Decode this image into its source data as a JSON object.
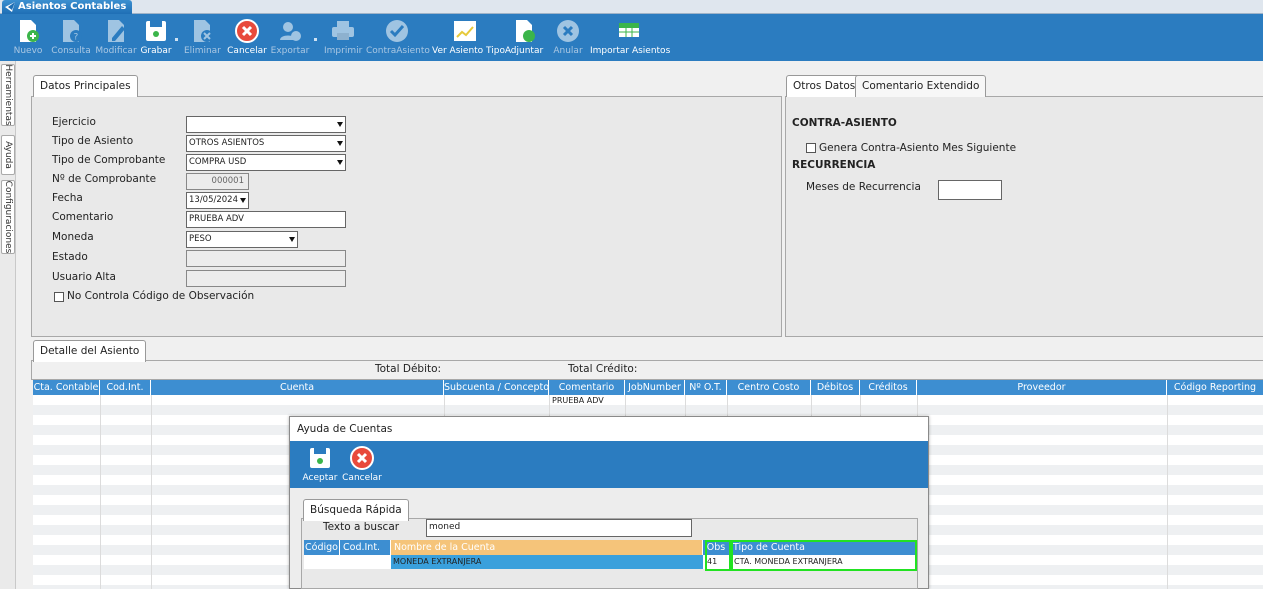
{
  "window": {
    "tab_title": "Asientos Contables"
  },
  "toolbar": {
    "buttons": [
      {
        "label": "Nuevo",
        "icon": "new-document-icon"
      },
      {
        "label": "Consulta",
        "icon": "query-document-icon"
      },
      {
        "label": "Modificar",
        "icon": "edit-document-icon"
      },
      {
        "label": "Grabar",
        "icon": "save-disk-icon"
      },
      {
        "label": "Eliminar",
        "icon": "delete-document-icon"
      },
      {
        "label": "Cancelar",
        "icon": "cancel-circle-icon"
      },
      {
        "label": "Exportar",
        "icon": "export-user-icon"
      },
      {
        "label": "Imprimir",
        "icon": "printer-icon"
      },
      {
        "label": "ContraAsiento",
        "icon": "checkmark-circle-icon"
      },
      {
        "label": "Ver Asiento Tipo",
        "icon": "chart-icon"
      },
      {
        "label": "Adjuntar",
        "icon": "attach-document-icon"
      },
      {
        "label": "Anular",
        "icon": "void-circle-icon"
      },
      {
        "label": "Importar Asientos",
        "icon": "excel-import-icon"
      }
    ]
  },
  "side_tabs": [
    "Herramientas",
    "Ayuda",
    "Configuraciones"
  ],
  "datos_principales": {
    "tab_label": "Datos Principales",
    "ejercicio": {
      "label": "Ejercicio",
      "value": ""
    },
    "tipo_asiento": {
      "label": "Tipo de Asiento",
      "value": "OTROS ASIENTOS"
    },
    "tipo_comprobante": {
      "label": "Tipo de Comprobante",
      "value": "COMPRA USD"
    },
    "nro_comprobante": {
      "label": "Nº de Comprobante",
      "value": "000001"
    },
    "fecha": {
      "label": "Fecha",
      "value": "13/05/2024"
    },
    "comentario": {
      "label": "Comentario",
      "value": "PRUEBA ADV"
    },
    "moneda": {
      "label": "Moneda",
      "value": "PESO"
    },
    "estado": {
      "label": "Estado",
      "value": ""
    },
    "usuario_alta": {
      "label": "Usuario Alta",
      "value": ""
    },
    "no_controla_label": "No Controla Código de Observación"
  },
  "otros_datos": {
    "tab_label": "Otros Datos",
    "tab2_label": "Comentario Extendido",
    "contra_asiento_heading": "CONTRA-ASIENTO",
    "genera_label": "Genera Contra-Asiento Mes Siguiente",
    "recurrencia_heading": "RECURRENCIA",
    "meses_label": "Meses de Recurrencia",
    "meses_value": ""
  },
  "detalle": {
    "tab_label": "Detalle del Asiento",
    "total_debito_label": "Total Débito:",
    "total_credito_label": "Total Crédito:",
    "columns": [
      "Cta. Contable",
      "Cod.Int.",
      "Cuenta",
      "Subcuenta / Concepto",
      "Comentario",
      "JobNumber",
      "Nº O.T.",
      "Centro Costo",
      "Débitos",
      "Créditos",
      "Proveedor",
      "Código Reporting"
    ],
    "row1_comentario": "PRUEBA ADV"
  },
  "dialog": {
    "title": "Ayuda de Cuentas",
    "aceptar_label": "Aceptar",
    "cancelar_label": "Cancelar",
    "search_tab_label": "Búsqueda Rápida",
    "search_label": "Texto a buscar",
    "search_value": "moned",
    "columns": [
      "Código",
      "Cod.Int.",
      "Nombre de la Cuenta",
      "Obs",
      "Tipo de Cuenta"
    ],
    "rows": [
      {
        "codigo": "",
        "cod_int": "",
        "nombre": "MONEDA EXTRANJERA",
        "obs": "41",
        "tipo": "CTA. MONEDA EXTRANJERA"
      }
    ]
  },
  "colors": {
    "toolbar": "#2b7cc0",
    "grid_header": "#3d8ed1",
    "selected_row": "#3aa0dc",
    "header_orange": "#f5c47a",
    "highlight": "#22e222"
  }
}
